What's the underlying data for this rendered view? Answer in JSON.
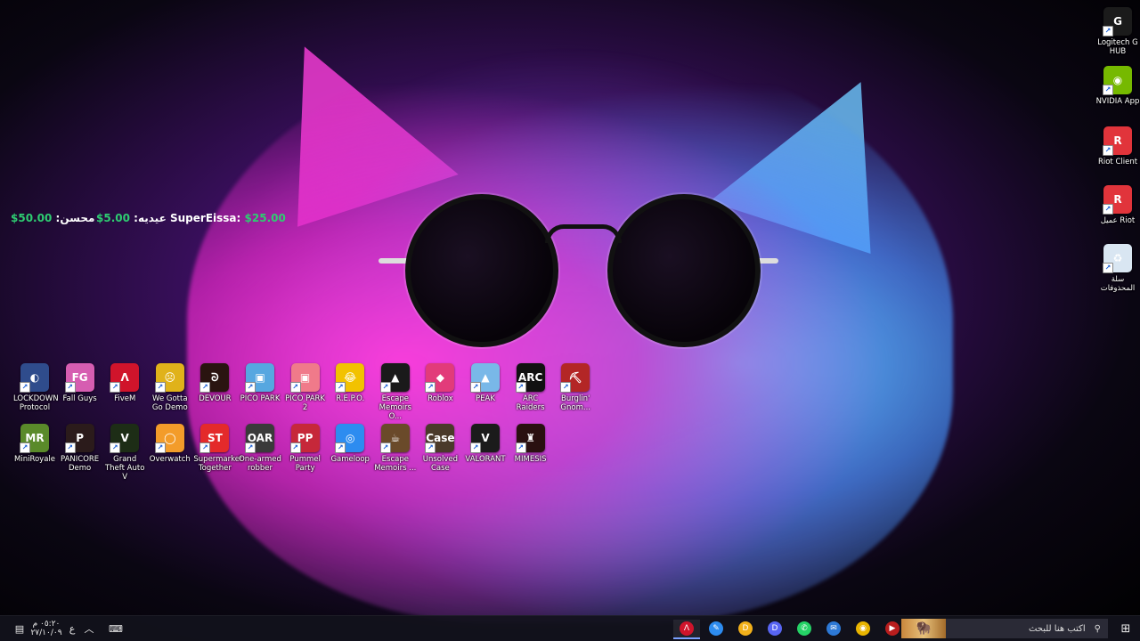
{
  "balances": [
    {
      "name": "محسن:",
      "amount": "50.00$"
    },
    {
      "name": "عيديه:",
      "amount": "5.00$"
    },
    {
      "name": "SuperEissa:",
      "amount": "$25.00"
    }
  ],
  "right_icons": [
    {
      "label": "Logitech G HUB",
      "icon": "logitech-g-icon",
      "color": "#1b1b1b",
      "glyph": "G"
    },
    {
      "label": "NVIDIA App",
      "icon": "nvidia-icon",
      "color": "#76b900",
      "glyph": "◉"
    },
    {
      "label": "Riot Client",
      "icon": "riot-icon",
      "color": "#e1343b",
      "glyph": "R"
    },
    {
      "label": "عميل Riot",
      "icon": "riot-icon",
      "color": "#e1343b",
      "glyph": "R"
    },
    {
      "label": "سلة المحذوفات",
      "icon": "recycle-bin-icon",
      "color": "#d9e6f2",
      "glyph": "♻"
    }
  ],
  "row1": [
    {
      "label": "LOCKDOWN Protocol",
      "icon": "lockdown-protocol-icon",
      "color": "#2f4c8c",
      "glyph": "◐"
    },
    {
      "label": "Fall Guys",
      "icon": "fall-guys-icon",
      "color": "#d65db1",
      "glyph": "FG"
    },
    {
      "label": "FiveM",
      "icon": "fivem-icon",
      "color": "#d0142b",
      "glyph": "Λ"
    },
    {
      "label": "We Gotta Go Demo",
      "icon": "we-gotta-go-icon",
      "color": "#e0b21a",
      "glyph": "☹"
    },
    {
      "label": "DEVOUR",
      "icon": "devour-icon",
      "color": "#2a1410",
      "glyph": "ᘐ"
    },
    {
      "label": "PICO PARK",
      "icon": "pico-park-icon",
      "color": "#56a7e0",
      "glyph": "▣"
    },
    {
      "label": "PICO PARK 2",
      "icon": "pico-park-2-icon",
      "color": "#f07a8a",
      "glyph": "▣"
    },
    {
      "label": "R.E.P.O.",
      "icon": "repo-icon",
      "color": "#f2c200",
      "glyph": "😂"
    },
    {
      "label": "Escape Memoirs O...",
      "icon": "escape-memoirs-icon",
      "color": "#1a1a1a",
      "glyph": "▲"
    },
    {
      "label": "Roblox",
      "icon": "roblox-icon",
      "color": "#e23b7a",
      "glyph": "◆"
    },
    {
      "label": "PEAK",
      "icon": "peak-icon",
      "color": "#79b8e8",
      "glyph": "▲"
    },
    {
      "label": "ARC Raiders",
      "icon": "arc-raiders-icon",
      "color": "#111111",
      "glyph": "ARC"
    },
    {
      "label": "Burglin' Gnom...",
      "icon": "burglin-gnomes-icon",
      "color": "#b32626",
      "glyph": "⛏"
    }
  ],
  "row2": [
    {
      "label": "MiniRoyale",
      "icon": "miniroyale-icon",
      "color": "#5a8a2a",
      "glyph": "MR"
    },
    {
      "label": "PANICORE Demo",
      "icon": "panicore-icon",
      "color": "#2b1b1b",
      "glyph": "P"
    },
    {
      "label": "Grand Theft Auto V",
      "icon": "gta-v-icon",
      "color": "#1d2d16",
      "glyph": "V"
    },
    {
      "label": "Overwatch",
      "icon": "overwatch-icon",
      "color": "#f39c2a",
      "glyph": "◯"
    },
    {
      "label": "Supermarket Together",
      "icon": "supermarket-together-icon",
      "color": "#e42a2a",
      "glyph": "ST"
    },
    {
      "label": "One-armed robber",
      "icon": "one-armed-robber-icon",
      "color": "#3a3a3a",
      "glyph": "OAR"
    },
    {
      "label": "Pummel Party",
      "icon": "pummel-party-icon",
      "color": "#c6283a",
      "glyph": "PP"
    },
    {
      "label": "Gameloop",
      "icon": "gameloop-icon",
      "color": "#2d8cf0",
      "glyph": "◎"
    },
    {
      "label": "Escape Memoirs ...",
      "icon": "escape-memoirs-icon",
      "color": "#6a4a2a",
      "glyph": "☕"
    },
    {
      "label": "Unsolved Case",
      "icon": "unsolved-case-icon",
      "color": "#4a3a2a",
      "glyph": "Case"
    },
    {
      "label": "VALORANT",
      "icon": "valorant-icon",
      "color": "#1b1b1b",
      "glyph": "V"
    },
    {
      "label": "MIMESIS",
      "icon": "mimesis-icon",
      "color": "#2a1010",
      "glyph": "♜"
    }
  ],
  "taskbar": {
    "search_placeholder": "اكتب هنا للبحث",
    "clock_time": "٠٥:٢٠ م",
    "clock_date": "٢٧/١٠/٠٩",
    "lang": "ع",
    "apps": [
      {
        "icon": "fivem-tray-icon",
        "color": "#d0142b",
        "glyph": "Λ"
      },
      {
        "icon": "tool-icon",
        "color": "#2d8cf0",
        "glyph": "✎"
      },
      {
        "icon": "discord-canary-icon",
        "color": "#f2b01a",
        "glyph": "D"
      },
      {
        "icon": "discord-icon",
        "color": "#5865f2",
        "glyph": "D"
      },
      {
        "icon": "whatsapp-icon",
        "color": "#25d366",
        "glyph": "✆"
      },
      {
        "icon": "mail-icon",
        "color": "#2d79d6",
        "glyph": "✉"
      },
      {
        "icon": "chrome-icon",
        "color": "#e8b400",
        "glyph": "◉"
      },
      {
        "icon": "streaming-app-icon",
        "color": "#b81d1d",
        "glyph": "▶"
      }
    ]
  }
}
